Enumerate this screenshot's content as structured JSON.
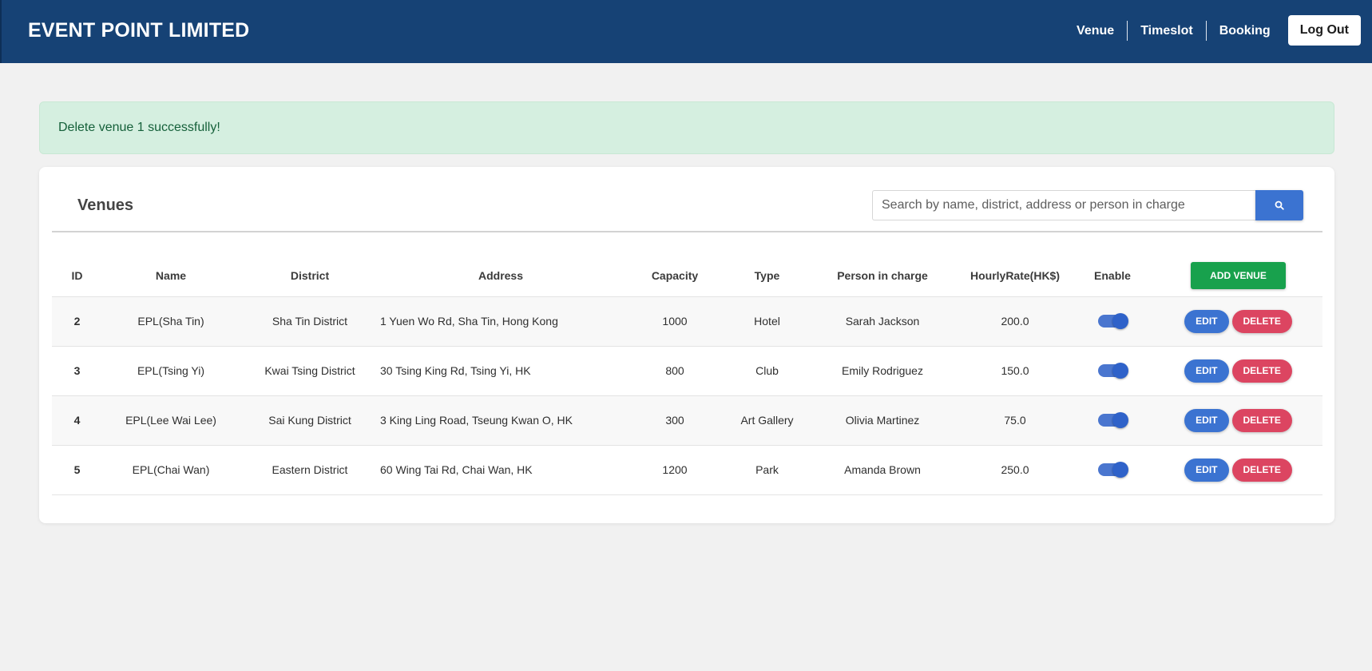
{
  "header": {
    "brand": "EVENT POINT LIMITED",
    "nav": [
      "Venue",
      "Timeslot",
      "Booking"
    ],
    "logout_label": "Log Out"
  },
  "alert": {
    "message": "Delete venue 1 successfully!"
  },
  "venues": {
    "title": "Venues",
    "search_placeholder": "Search by name, district, address or person in charge",
    "add_label": "ADD VENUE",
    "edit_label": "EDIT",
    "delete_label": "DELETE",
    "columns": [
      "ID",
      "Name",
      "District",
      "Address",
      "Capacity",
      "Type",
      "Person in charge",
      "HourlyRate(HK$)",
      "Enable"
    ],
    "rows": [
      {
        "id": "2",
        "name": "EPL(Sha Tin)",
        "district": "Sha Tin District",
        "address": "1 Yuen Wo Rd, Sha Tin, Hong Kong",
        "capacity": "1000",
        "type": "Hotel",
        "person": "Sarah Jackson",
        "rate": "200.0",
        "enabled": true
      },
      {
        "id": "3",
        "name": "EPL(Tsing Yi)",
        "district": "Kwai Tsing District",
        "address": "30 Tsing King Rd, Tsing Yi, HK",
        "capacity": "800",
        "type": "Club",
        "person": "Emily Rodriguez",
        "rate": "150.0",
        "enabled": true
      },
      {
        "id": "4",
        "name": "EPL(Lee Wai Lee)",
        "district": "Sai Kung District",
        "address": "3 King Ling Road, Tseung Kwan O, HK",
        "capacity": "300",
        "type": "Art Gallery",
        "person": "Olivia Martinez",
        "rate": "75.0",
        "enabled": true
      },
      {
        "id": "5",
        "name": "EPL(Chai Wan)",
        "district": "Eastern District",
        "address": "60 Wing Tai Rd, Chai Wan, HK",
        "capacity": "1200",
        "type": "Park",
        "person": "Amanda Brown",
        "rate": "250.0",
        "enabled": true
      }
    ]
  },
  "colors": {
    "header_bg": "#164275",
    "primary": "#3b73d1",
    "danger": "#dc4561",
    "success": "#18a14d",
    "alert_bg": "#d5efe0"
  },
  "icons": {
    "search_button": "search-icon"
  }
}
